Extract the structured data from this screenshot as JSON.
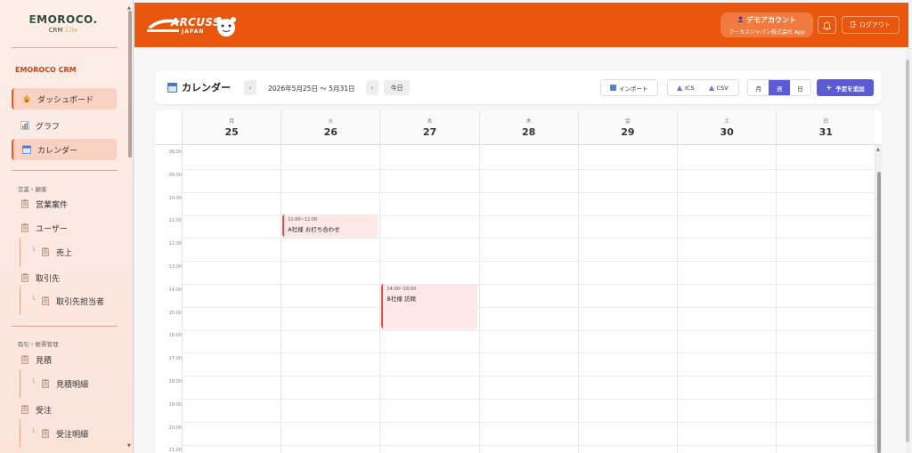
{
  "sidebar": {
    "logo_main": "MOROCO.",
    "logo_prefix": "E",
    "logo_sub": "CRM",
    "logo_lite": "Lite",
    "app_name": "EMOROCO CRM",
    "nav_top": [
      {
        "label": "ダッシュボード",
        "icon": "home-icon",
        "active": true
      },
      {
        "label": "グラフ",
        "icon": "chart-icon",
        "active": false
      },
      {
        "label": "カレンダー",
        "icon": "calendar-icon",
        "active": true
      }
    ],
    "section1": "営業・顧客",
    "items1": [
      {
        "label": "営業案件",
        "sub": false
      },
      {
        "label": "ユーザー",
        "sub": false
      },
      {
        "label": "売上",
        "sub": true
      },
      {
        "label": "取引先",
        "sub": false
      },
      {
        "label": "取引先担当者",
        "sub": true
      }
    ],
    "section2": "取引・帳票管理",
    "items2": [
      {
        "label": "見積",
        "sub": false
      },
      {
        "label": "見積明細",
        "sub": true
      },
      {
        "label": "受注",
        "sub": false
      },
      {
        "label": "受注明細",
        "sub": true
      }
    ]
  },
  "header": {
    "brand": "ARCUSS",
    "brand_sub": "JAPAN",
    "user_name": "デモアカウント",
    "company": "アーカスジャパン株式会社 App",
    "logout": "ログアウト",
    "color": "#e8570d"
  },
  "toolbar": {
    "title": "カレンダー",
    "prev": "‹",
    "next": "›",
    "range": "2026年5月25日 〜 5月31日",
    "today": "今日",
    "import": "インポート",
    "ics": "ICS",
    "csv": "CSV",
    "views": [
      "月",
      "週",
      "日"
    ],
    "active_view": "週",
    "add": "予定を追加"
  },
  "calendar": {
    "days": [
      {
        "dow": "月",
        "num": "25"
      },
      {
        "dow": "火",
        "num": "26"
      },
      {
        "dow": "水",
        "num": "27"
      },
      {
        "dow": "木",
        "num": "28"
      },
      {
        "dow": "金",
        "num": "29"
      },
      {
        "dow": "土",
        "num": "30"
      },
      {
        "dow": "日",
        "num": "31"
      }
    ],
    "times": [
      "08:00",
      "09:00",
      "10:00",
      "11:00",
      "12:00",
      "13:00",
      "14:00",
      "15:00",
      "16:00",
      "17:00",
      "18:00",
      "19:00",
      "20:00",
      "21:00"
    ],
    "events": [
      {
        "day_index": 1,
        "start": 11.0,
        "end": 12.0,
        "time": "11:00~12:00",
        "title": "A社様 お打ち合わせ"
      },
      {
        "day_index": 2,
        "start": 14.0,
        "end": 16.0,
        "time": "14:00~16:00",
        "title": "B社様 訪問"
      }
    ]
  }
}
